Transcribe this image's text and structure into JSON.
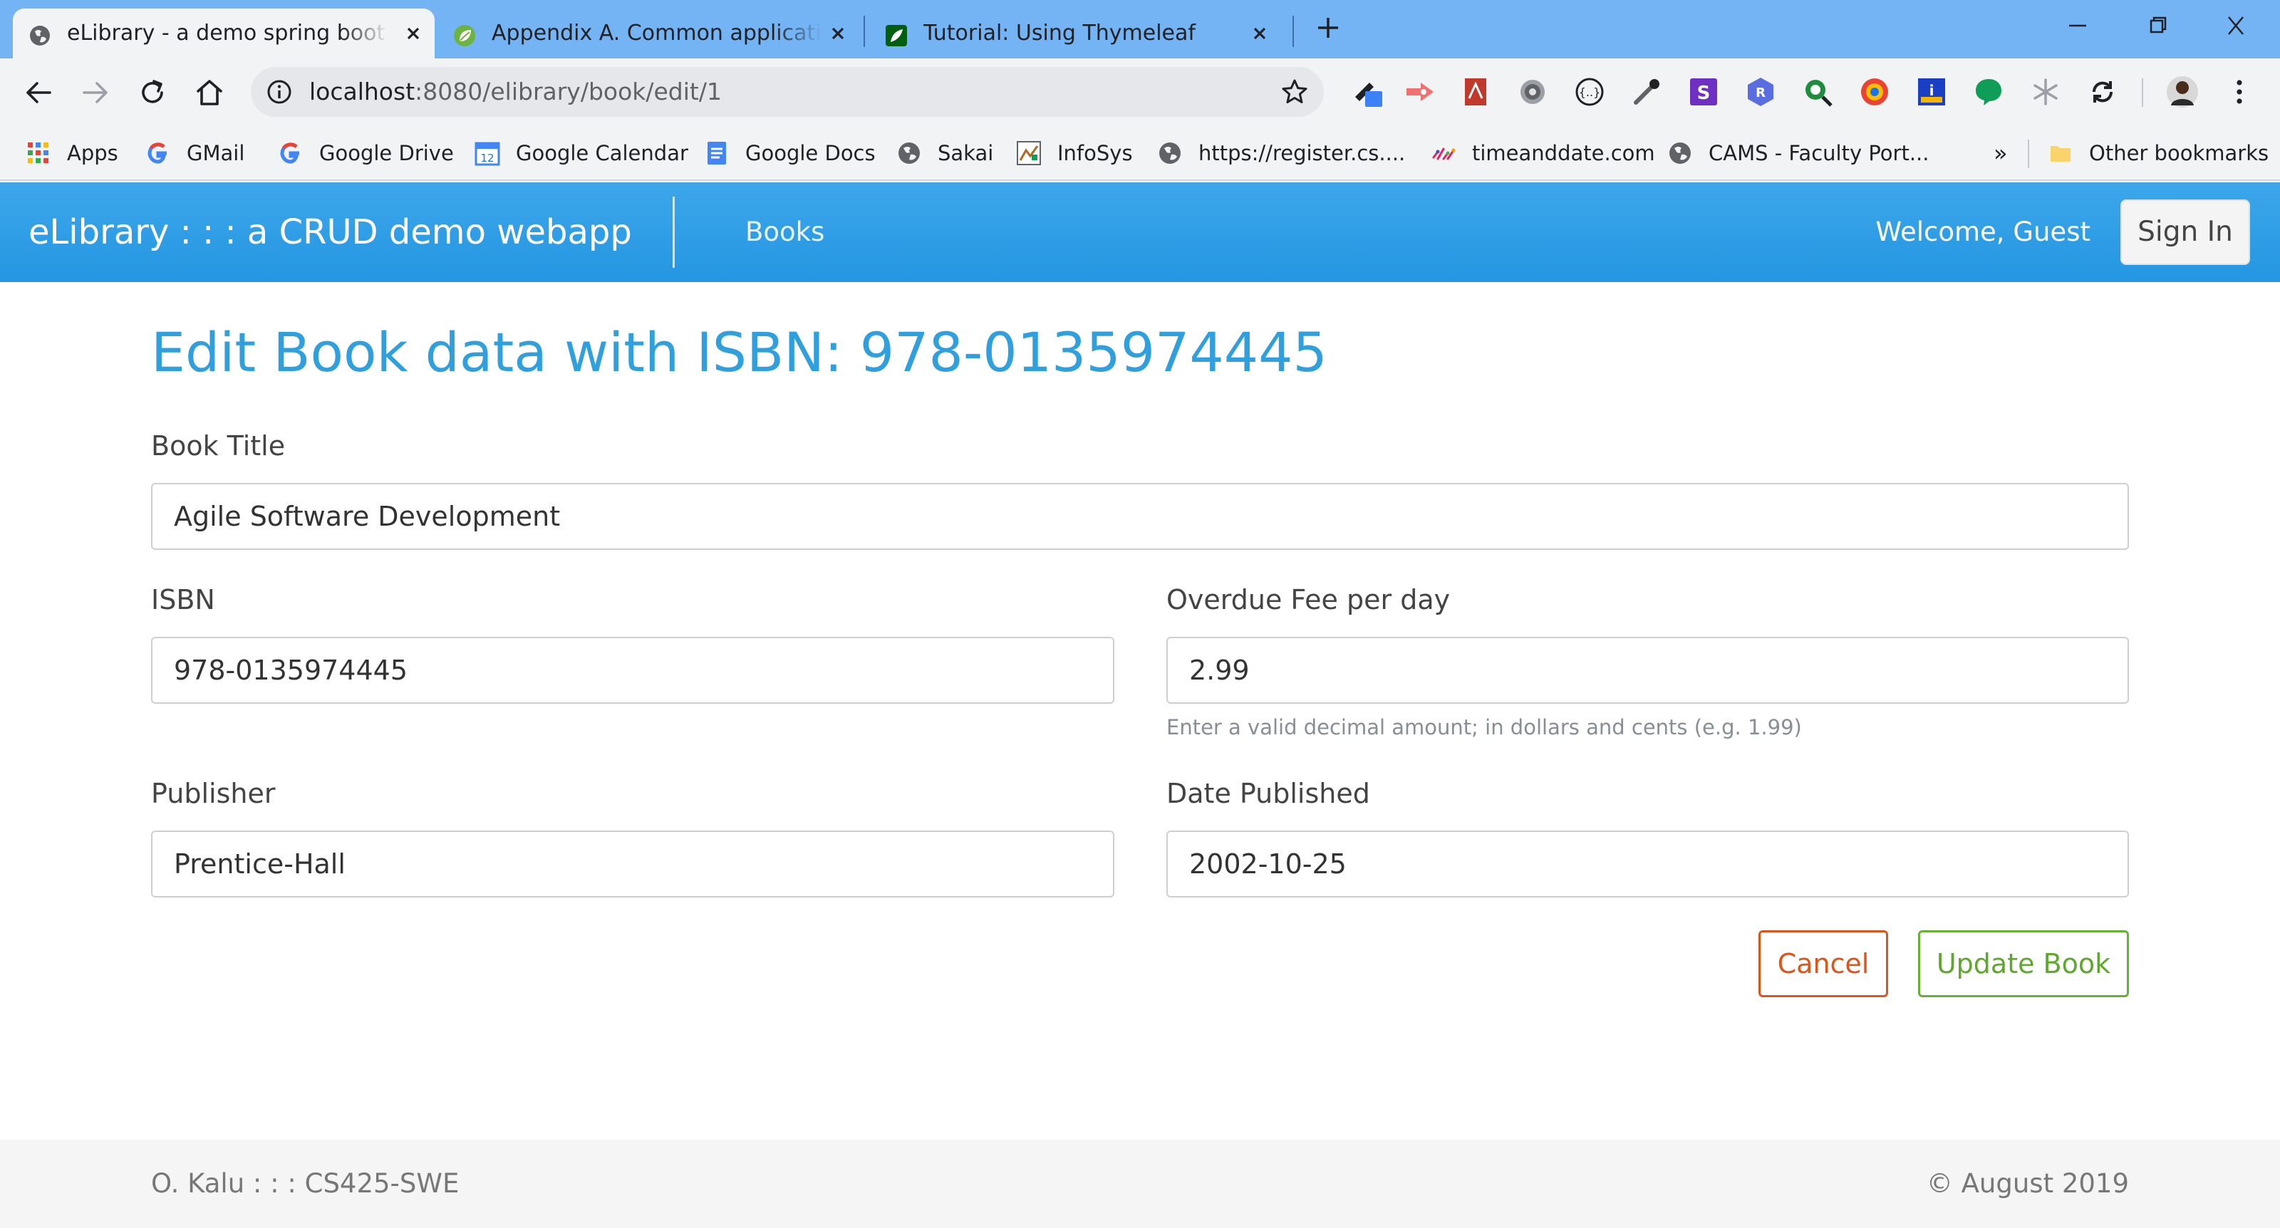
{
  "browser": {
    "tabs": [
      {
        "title": "eLibrary - a demo spring boot webapp",
        "active": true,
        "icon": "globe-icon"
      },
      {
        "title": "Appendix A. Common application properties",
        "active": false,
        "icon": "spring-leaf-icon"
      },
      {
        "title": "Tutorial: Using Thymeleaf",
        "active": false,
        "icon": "thymeleaf-icon"
      }
    ],
    "url": {
      "host": "localhost",
      "path": ":8080/elibrary/book/edit/1"
    },
    "bookmarks": [
      {
        "label": "Apps",
        "icon": "apps-grid-icon"
      },
      {
        "label": "GMail",
        "icon": "google-g-icon"
      },
      {
        "label": "Google Drive",
        "icon": "google-g-icon"
      },
      {
        "label": "Google Calendar",
        "icon": "calendar-icon",
        "badge": "12"
      },
      {
        "label": "Google Docs",
        "icon": "docs-icon"
      },
      {
        "label": "Sakai",
        "icon": "globe-icon"
      },
      {
        "label": "InfoSys",
        "icon": "infosys-icon"
      },
      {
        "label": "https://register.cs....",
        "icon": "globe-icon"
      },
      {
        "label": "timeanddate.com",
        "icon": "timeanddate-icon"
      },
      {
        "label": "CAMS - Faculty Port...",
        "icon": "globe-icon"
      }
    ],
    "bookmarks_overflow": "»",
    "other_bookmarks": "Other bookmarks"
  },
  "app": {
    "brand": "eLibrary : : : a CRUD demo webapp",
    "nav_books": "Books",
    "welcome": "Welcome, Guest",
    "sign_in": "Sign In"
  },
  "form": {
    "heading": "Edit Book data with ISBN: 978-0135974445",
    "title_label": "Book Title",
    "title_value": "Agile Software Development",
    "isbn_label": "ISBN",
    "isbn_value": "978-0135974445",
    "fee_label": "Overdue Fee per day",
    "fee_value": "2.99",
    "fee_help": "Enter a valid decimal amount; in dollars and cents (e.g. 1.99)",
    "publisher_label": "Publisher",
    "publisher_value": "Prentice-Hall",
    "date_label": "Date Published",
    "date_value": "2002-10-25",
    "cancel": "Cancel",
    "update": "Update Book"
  },
  "footer": {
    "left": "O. Kalu : : : CS425-SWE",
    "right": "© August 2019"
  },
  "colors": {
    "navbar": "#2d9de6",
    "heading": "#2fa0dd",
    "cancel": "#e0531b",
    "update": "#66b032"
  }
}
